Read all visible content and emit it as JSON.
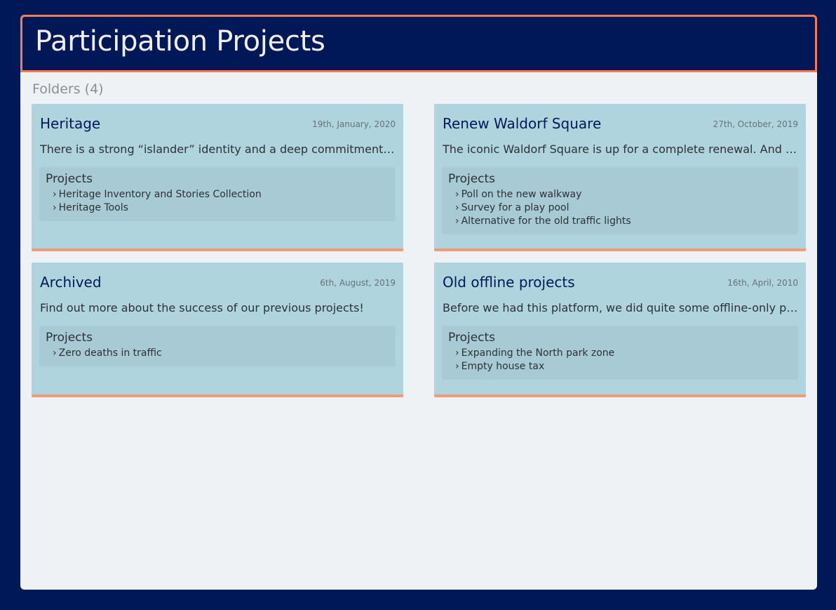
{
  "header": {
    "title": "Participation Projects"
  },
  "folders_heading": "Folders (4)",
  "folders": [
    {
      "title": "Heritage",
      "date": "19th, January, 2020",
      "description": "There is a strong “islander” identity and a deep commitment to the island’s heritage.",
      "projects_label": "Projects",
      "projects": [
        "Heritage Inventory and Stories Collection",
        "Heritage Tools"
      ]
    },
    {
      "title": "Renew Waldorf Square",
      "date": "27th, October, 2019",
      "description": "The iconic Waldorf Square is up for a complete renewal. And we want your input.",
      "projects_label": "Projects",
      "projects": [
        "Poll on the new walkway",
        "Survey for a play pool",
        "Alternative for the old traffic lights"
      ]
    },
    {
      "title": "Archived",
      "date": "6th, August, 2019",
      "description": "Find out more about the success of our previous projects!",
      "projects_label": "Projects",
      "projects": [
        "Zero deaths in traffic"
      ]
    },
    {
      "title": "Old offline projects",
      "date": "16th, April, 2010",
      "description": "Before we had this platform, we did quite some offline-only participation projects.",
      "projects_label": "Projects",
      "projects": [
        "Expanding the North park zone",
        "Empty house tax"
      ]
    }
  ],
  "icons": {
    "project_bullet": "chevron-right-icon"
  },
  "colors": {
    "background": "#001858",
    "accent": "#f57c4c",
    "card": "#b0d4de",
    "card_border": "#f29a77",
    "title_text": "#001858"
  }
}
